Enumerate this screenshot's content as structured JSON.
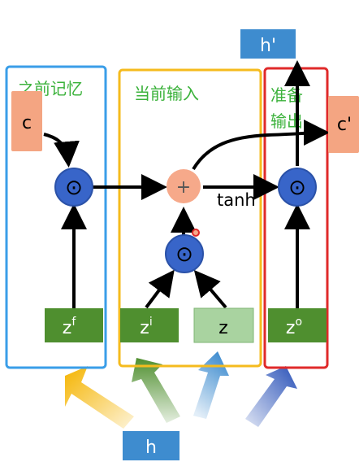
{
  "labels": {
    "forget_region": "之前记忆",
    "input_region": "当前输入",
    "output_region_line1": "准备",
    "output_region_line2": "输出",
    "cell_in": "c",
    "cell_out": "c'",
    "hidden_out": "h'",
    "hidden_in": "h",
    "plus": "+",
    "odot": "⊙",
    "tanh": "tanh",
    "z_forget": "z",
    "z_forget_sup": "f",
    "z_input": "z",
    "z_input_sup": "i",
    "z_plain": "z",
    "z_output": "z",
    "z_output_sup": "o"
  },
  "colors": {
    "region_forget": "#3a9ee8",
    "region_input": "#f5bb1e",
    "region_output": "#e02a2a",
    "gate_box": "#4f8f2f",
    "z_box": "#a9d3a0",
    "cell_box": "#f4a582",
    "hidden_box": "#3e8ccf",
    "odot_circle": "#3865c9",
    "plus_circle": "#f6a98a",
    "region_text": "#3bb23b"
  }
}
